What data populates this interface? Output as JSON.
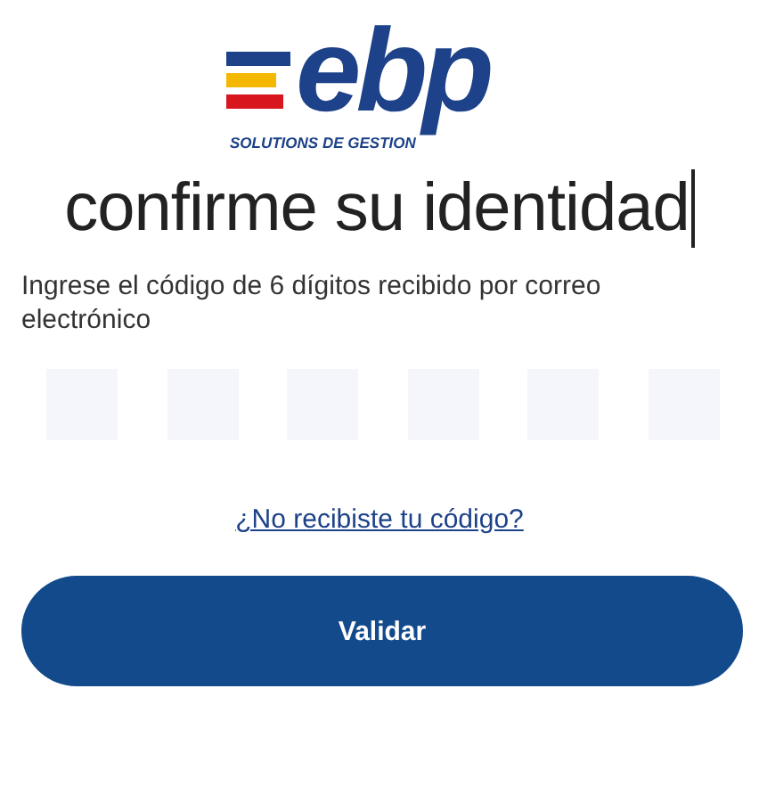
{
  "logo": {
    "wordmark": "ebp",
    "tagline": "SOLUTIONS DE GESTION"
  },
  "title": "confirme su identidad",
  "instructions": "Ingrese el código de 6 dígitos recibido por correo electrónico",
  "code_fields": [
    {
      "kind": "digit"
    },
    {
      "kind": "digit"
    },
    {
      "kind": "digit"
    },
    {
      "kind": "digit"
    },
    {
      "kind": "digit"
    },
    {
      "kind": "digit"
    }
  ],
  "resend_link": "¿No recibiste tu código?",
  "submit_button": "Validar"
}
